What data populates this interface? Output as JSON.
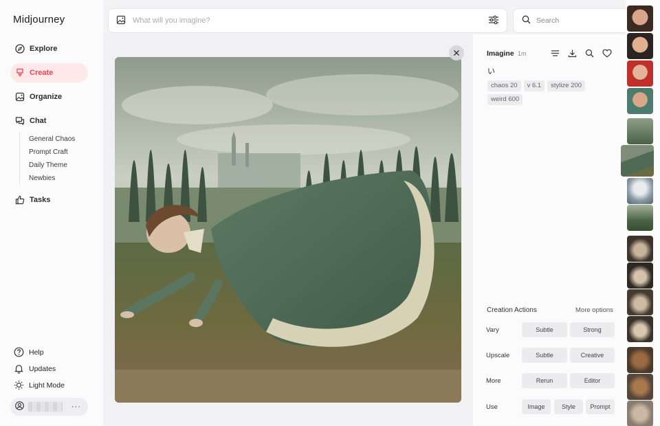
{
  "app": {
    "brand": "Midjourney"
  },
  "sidebar": {
    "items": [
      {
        "label": "Explore",
        "icon": "compass-icon"
      },
      {
        "label": "Create",
        "icon": "brush-icon",
        "active": true
      },
      {
        "label": "Organize",
        "icon": "image-icon"
      },
      {
        "label": "Chat",
        "icon": "chat-icon"
      },
      {
        "label": "Tasks",
        "icon": "thumbs-up-icon"
      }
    ],
    "chat_rooms": [
      "General Chaos",
      "Prompt Craft",
      "Daily Theme",
      "Newbies"
    ],
    "bottom": [
      {
        "label": "Help",
        "icon": "help-icon"
      },
      {
        "label": "Updates",
        "icon": "bell-icon"
      },
      {
        "label": "Light Mode",
        "icon": "sun-icon"
      }
    ],
    "user_more": "···"
  },
  "topbar": {
    "prompt_placeholder": "What will you imagine?",
    "search_placeholder": "Search"
  },
  "details": {
    "title": "Imagine",
    "time": "1m",
    "prompt": "い",
    "tags": [
      "chaos 20",
      "v 6.1",
      "stylize 200",
      "weird 600"
    ],
    "creation_actions": {
      "title": "Creation Actions",
      "more": "More options",
      "rows": [
        {
          "label": "Vary",
          "buttons": [
            "Subtle",
            "Strong"
          ]
        },
        {
          "label": "Upscale",
          "buttons": [
            "Subtle",
            "Creative"
          ]
        },
        {
          "label": "More",
          "buttons": [
            "Rerun",
            "Editor"
          ]
        },
        {
          "label": "Use",
          "buttons": [
            "Image",
            "Style",
            "Prompt"
          ]
        }
      ]
    }
  },
  "colors": {
    "accent": "#ef4452",
    "accent_bg": "#fde9ea"
  }
}
